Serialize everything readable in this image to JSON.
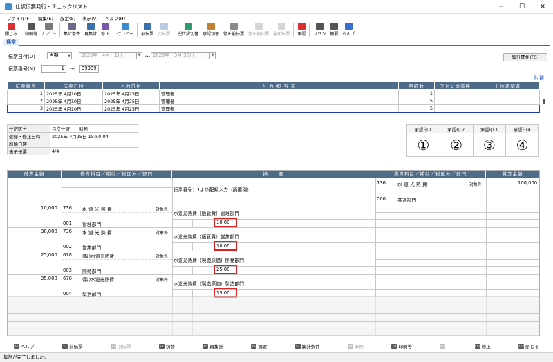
{
  "window": {
    "title": "仕訳伝票発行・チェックリスト",
    "minimize": "─",
    "maximize": "☐",
    "close": "✕"
  },
  "menu": [
    "ファイル(F)",
    "編集(E)",
    "設定(S)",
    "表示(V)",
    "ヘルプ(H)"
  ],
  "toolbar": [
    {
      "label": "閉じる",
      "icon": "close-icon",
      "color": "#d83030",
      "enabled": true
    },
    {
      "label": "印刷等",
      "icon": "print-icon",
      "color": "#555555",
      "enabled": true
    },
    {
      "label": "ﾌﾟﾚﾋﾞｭｰ",
      "icon": "preview-icon",
      "color": "#7a7a7a",
      "enabled": true
    },
    {
      "label": "集計条件",
      "icon": "condition-icon",
      "color": "#6a6a8a",
      "enabled": true
    },
    {
      "label": "再集計",
      "icon": "recalc-icon",
      "color": "#3a6fb0",
      "enabled": true
    },
    {
      "label": "修正",
      "icon": "edit-icon",
      "color": "#7a5aa8",
      "enabled": true
    },
    {
      "label": "行コピー",
      "icon": "row-copy-icon",
      "color": "#3a8ad0",
      "enabled": true
    },
    {
      "label": "前伝票",
      "icon": "prev-voucher-icon",
      "color": "#3a6fb0",
      "enabled": true
    },
    {
      "label": "次伝票",
      "icon": "next-voucher-icon",
      "color": "#3a6fb0",
      "enabled": false
    },
    {
      "label": "逆仕訳切替",
      "icon": "reverse-icon",
      "color": "#2f9a6f",
      "enabled": true
    },
    {
      "label": "承認切替",
      "icon": "approve-toggle-icon",
      "color": "#c08030",
      "enabled": true
    },
    {
      "label": "修正前伝票",
      "icon": "before-edit-icon",
      "color": "#8a8a8a",
      "enabled": true
    },
    {
      "label": "修正後伝票",
      "icon": "after-edit-icon",
      "color": "#8a8a8a",
      "enabled": false
    },
    {
      "label": "最新伝票",
      "icon": "latest-icon",
      "color": "#8a8a8a",
      "enabled": false
    },
    {
      "label": "承認",
      "icon": "stamp-icon",
      "color": "#d83030",
      "enabled": true
    },
    {
      "label": "フセン",
      "icon": "sticky-icon",
      "color": "#555555",
      "enabled": true
    },
    {
      "label": "摘要",
      "icon": "memo-icon",
      "color": "#555555",
      "enabled": true
    },
    {
      "label": "ヘルプ",
      "icon": "help-icon",
      "color": "#3a6fd0",
      "enabled": true
    }
  ],
  "tab": "通常",
  "form": {
    "date_label": "伝票日付(D)",
    "date_mode": "当期",
    "date_from": "2025年　4月　1日",
    "tilde": "～",
    "date_to": "2026年　3月 30日",
    "number_label": "伝票番号(N)",
    "number_from": "1",
    "number_to": "99999",
    "run_button": "集計開始(F5)",
    "dept_link": "財務"
  },
  "list": {
    "headers": [
      "伝票番号",
      "伝票日付",
      "入力日付",
      "入 力 担 当 者",
      "明細数",
      "フセンの有無",
      "上位承認者"
    ],
    "rows": [
      [
        "1",
        "2025年 4月10日",
        "2025年 4月25日",
        "管理者",
        "1",
        "",
        ""
      ],
      [
        "2",
        "2025年 4月10日",
        "2025年 4月25日",
        "管理者",
        "5",
        "",
        ""
      ],
      [
        "3",
        "2025年 4月10日",
        "2025年 4月25日",
        "管理者",
        "5",
        "",
        ""
      ]
    ]
  },
  "info": [
    [
      "仕訳区分",
      "月次仕訳　　財務"
    ],
    [
      "登録・修正日時",
      "2025年 4月25日 15:50:04"
    ],
    [
      "削除日時",
      ""
    ],
    [
      "表示伝票",
      "4/4"
    ]
  ],
  "approvals": {
    "headers": [
      "承認印１",
      "承認印２",
      "承認印３",
      "承認印４"
    ],
    "marks": [
      "①",
      "②",
      "③",
      "④"
    ]
  },
  "journal": {
    "headers": [
      "借方金額",
      "借方科目／補助／税区分／部門",
      "摘　　要",
      "貸方科目／補助／税区分／部門",
      "貸方金額"
    ],
    "top": {
      "memo": "伝票番号：1より配賦入力（摘要例）",
      "credit_code": "736",
      "credit_name": "水 道 光 熱 費",
      "credit_tax": "対象外",
      "credit_amount": "100,000",
      "credit_dept_code": "000",
      "credit_dept": "共通部門"
    },
    "entries": [
      {
        "amount": "10,000",
        "code": "736",
        "name": "水 道 光 熱 費",
        "tax": "対象外",
        "memo": "水道光熱費（販管費）管理部門",
        "dept_code": "001",
        "dept": "管理部門",
        "ratio": "10.00"
      },
      {
        "amount": "30,000",
        "code": "736",
        "name": "水 道 光 熱 費",
        "tax": "対象外",
        "memo": "水道光熱費（販管費）営業部門",
        "dept_code": "002",
        "dept": "営業部門",
        "ratio": "30.00"
      },
      {
        "amount": "25,000",
        "code": "678",
        "name": "(製)水道光熱費",
        "tax": "対象外",
        "memo": "水道光熱費（製造原価）開発部門",
        "dept_code": "003",
        "dept": "開発部門",
        "ratio": "25.00"
      },
      {
        "amount": "35,000",
        "code": "678",
        "name": "(製)水道光熱費",
        "tax": "対象外",
        "memo": "水道光熱費（製造原価）製造部門",
        "dept_code": "004",
        "dept": "製造部門",
        "ratio": "35.00"
      }
    ]
  },
  "fkeys": [
    {
      "key": "F1",
      "label": "ヘルプ",
      "enabled": true
    },
    {
      "key": "F2",
      "label": "前伝票",
      "enabled": true
    },
    {
      "key": "F3",
      "label": "次伝票",
      "enabled": false
    },
    {
      "key": "F4",
      "label": "切替",
      "enabled": true
    },
    {
      "key": "F5",
      "label": "再集計",
      "enabled": true
    },
    {
      "key": "F6",
      "label": "摘要",
      "enabled": true
    },
    {
      "key": "F7",
      "label": "集計条件",
      "enabled": true
    },
    {
      "key": "F8",
      "label": "参照",
      "enabled": false
    },
    {
      "key": "F9",
      "label": "印刷等",
      "enabled": true
    },
    {
      "key": "F10",
      "label": "",
      "enabled": false
    },
    {
      "key": "F11",
      "label": "修正",
      "enabled": true
    },
    {
      "key": "F12",
      "label": "閉じる",
      "enabled": true
    }
  ],
  "status": "集計が完了しました。"
}
